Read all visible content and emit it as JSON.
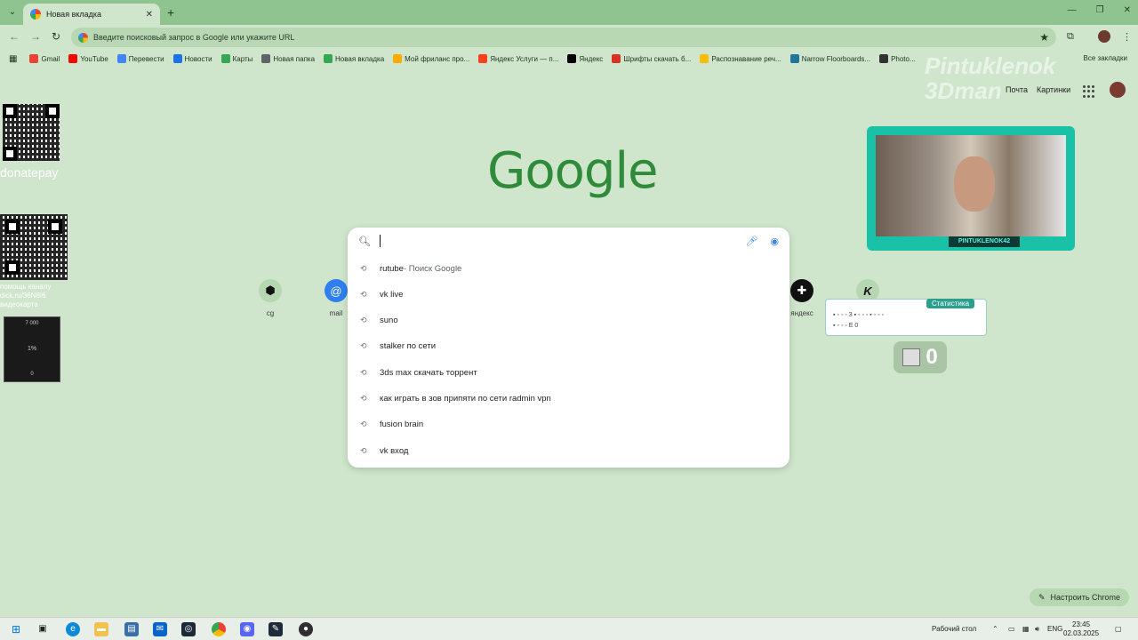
{
  "browser": {
    "tab_title": "Новая вкладка",
    "omnibox_placeholder": "Введите поисковый запрос в Google или укажите URL",
    "all_bookmarks": "Все закладки",
    "bookmarks": [
      {
        "label": "Gmail",
        "color": "#ea4335"
      },
      {
        "label": "YouTube",
        "color": "#ff0000"
      },
      {
        "label": "Перевести",
        "color": "#4285f4"
      },
      {
        "label": "Новости",
        "color": "#1a73e8"
      },
      {
        "label": "Карты",
        "color": "#34a853"
      },
      {
        "label": "Новая папка",
        "color": "#5f6368"
      },
      {
        "label": "Новая вкладка",
        "color": "#34a853"
      },
      {
        "label": "Мой фриланс про...",
        "color": "#f9ab00"
      },
      {
        "label": "Яндекс Услуги — п...",
        "color": "#fc3f1d"
      },
      {
        "label": "Яндекс",
        "color": "#000000"
      },
      {
        "label": "Шрифты скачать б...",
        "color": "#d93025"
      },
      {
        "label": "Распознавание реч...",
        "color": "#fbbc05"
      },
      {
        "label": "Narrow Floorboards...",
        "color": "#21759b"
      },
      {
        "label": "Photo...",
        "color": "#333333"
      }
    ]
  },
  "google": {
    "logo": "Google",
    "links": {
      "mail": "Почта",
      "images": "Картинки"
    },
    "search_value": "",
    "suggestions": [
      {
        "text": "rutube",
        "sub": " - Поиск Google"
      },
      {
        "text": "vk live",
        "sub": ""
      },
      {
        "text": "suno",
        "sub": ""
      },
      {
        "text": "stalker по сети",
        "sub": ""
      },
      {
        "text": "3ds max скачать торрент",
        "sub": ""
      },
      {
        "text": "как играть в зов припяти по сети radmin vpn",
        "sub": ""
      },
      {
        "text": "fusion brain",
        "sub": ""
      },
      {
        "text": "vk вход",
        "sub": ""
      }
    ],
    "shortcuts": [
      {
        "label": "cg",
        "glyph": "⬢"
      },
      {
        "label": "mail",
        "glyph": "@"
      },
      {
        "label": "яндекс",
        "glyph": "✚"
      },
      {
        "label": "",
        "glyph": "K"
      }
    ],
    "customize": "Настроить Chrome"
  },
  "overlay": {
    "watermark_line1": "Pintuklenok",
    "watermark_line2": "3Dman",
    "donatepay": "donatepay",
    "help_text": "помощь каналу dick.ru/36N8I6 видеокарта",
    "mini_card": [
      "7 000",
      "1%",
      "0"
    ],
    "cam_label": "PINTUKLENOK42",
    "stats_title": "Статистика",
    "stats_line1": "3  ",
    "stats_line2": "0",
    "counter": "0"
  },
  "taskbar": {
    "desktop_label": "Рабочий стол",
    "lang": "ENG",
    "time": "23:45",
    "date": "02.03.2025"
  }
}
